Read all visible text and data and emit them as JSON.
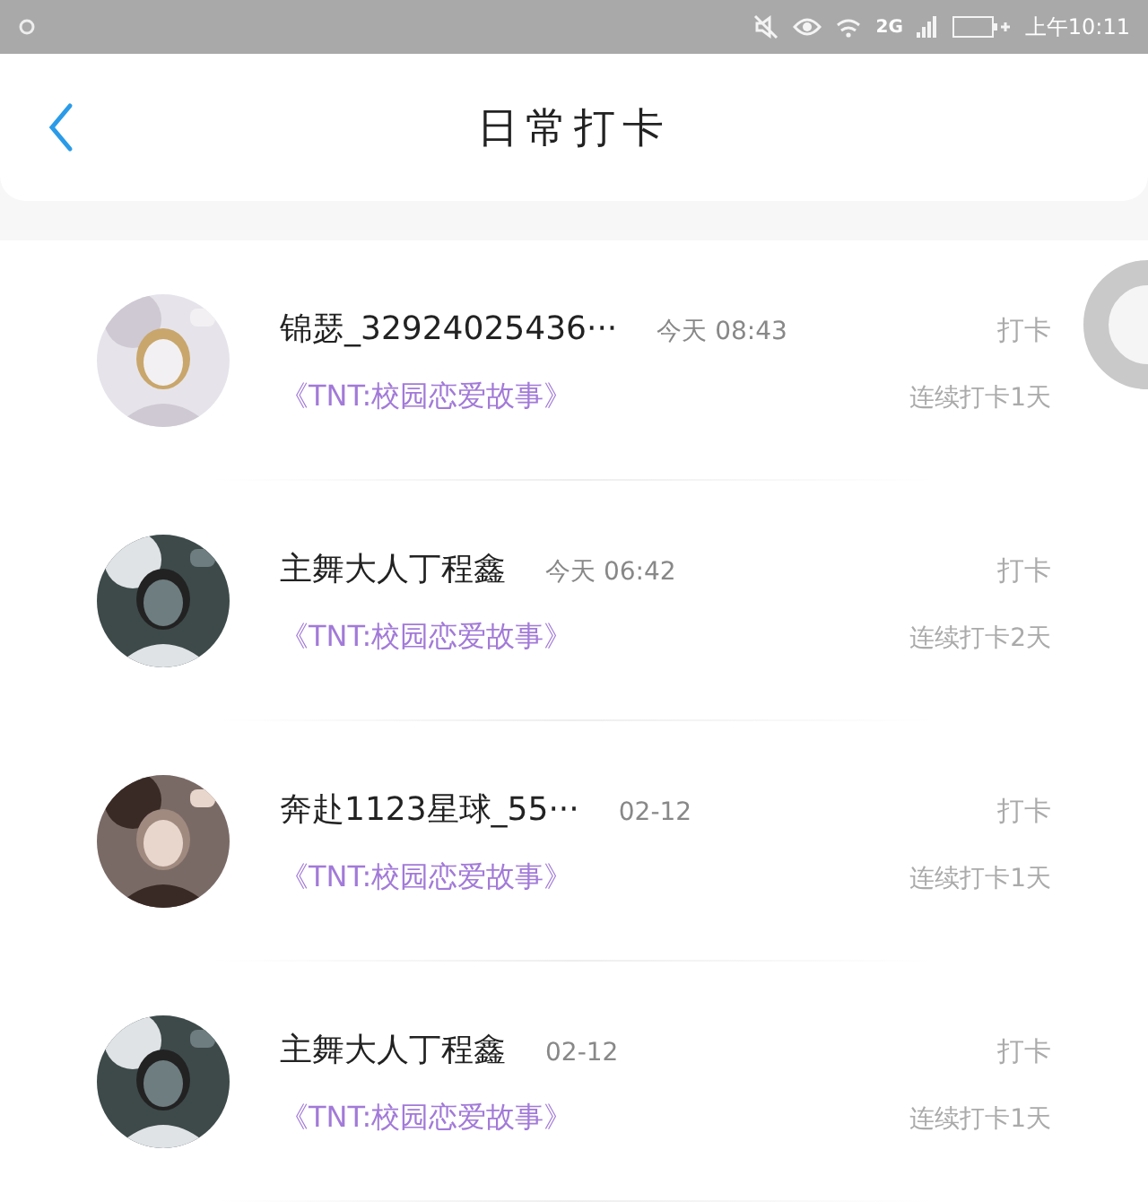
{
  "status_bar": {
    "network": "2G",
    "time": "上午10:11"
  },
  "header": {
    "title": "日常打卡"
  },
  "entries": [
    {
      "name": "锦瑟_32924025436···",
      "time": "今天 08:43",
      "action": "打卡",
      "book": "《TNT:校园恋爱故事》",
      "streak": "连续打卡1天"
    },
    {
      "name": "主舞大人丁程鑫",
      "time": "今天 06:42",
      "action": "打卡",
      "book": "《TNT:校园恋爱故事》",
      "streak": "连续打卡2天"
    },
    {
      "name": "奔赴1123星球_55···",
      "time": "02-12",
      "action": "打卡",
      "book": "《TNT:校园恋爱故事》",
      "streak": "连续打卡1天"
    },
    {
      "name": "主舞大人丁程鑫",
      "time": "02-12",
      "action": "打卡",
      "book": "《TNT:校园恋爱故事》",
      "streak": "连续打卡1天"
    }
  ]
}
